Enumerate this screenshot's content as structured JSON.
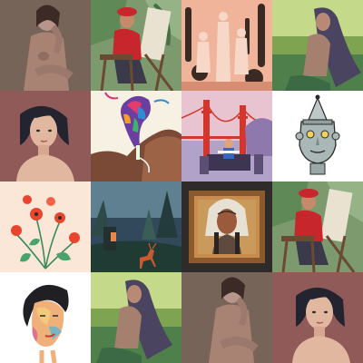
{
  "gallery": {
    "tiles": [
      {
        "subject": "seated-nude-figure-painting",
        "bg": "#6b5a50"
      },
      {
        "subject": "painter-in-red-beret-at-easel",
        "bg": "#7d9a6e"
      },
      {
        "subject": "figures-among-cacti",
        "bg": "#f0b49a"
      },
      {
        "subject": "long-haired-woman-in-green-landscape",
        "bg": "#9bbd6a"
      },
      {
        "subject": "portrait-woman-dark-bob",
        "bg": "#8f5a57"
      },
      {
        "subject": "colorful-bird-on-hill",
        "bg": "#f7f1e3"
      },
      {
        "subject": "golden-gate-bridge-workers",
        "bg": "#e8c3d0"
      },
      {
        "subject": "tin-man-head",
        "bg": "#ffffff"
      },
      {
        "subject": "red-poppy-flowers",
        "bg": "#fbe7d7"
      },
      {
        "subject": "deer-in-dark-forest",
        "bg": "#31495a"
      },
      {
        "subject": "native-chief-framed-portrait",
        "bg": "#2e2b2a"
      },
      {
        "subject": "painter-in-red-beret-at-easel",
        "bg": "#7d9a6e"
      },
      {
        "subject": "colorful-face-sketch",
        "bg": "#ffffff"
      },
      {
        "subject": "long-haired-woman-in-green-landscape",
        "bg": "#9bbd6a"
      },
      {
        "subject": "seated-nude-figure-painting",
        "bg": "#6b5a50"
      },
      {
        "subject": "portrait-woman-dark-bob",
        "bg": "#8f5a57"
      }
    ]
  }
}
